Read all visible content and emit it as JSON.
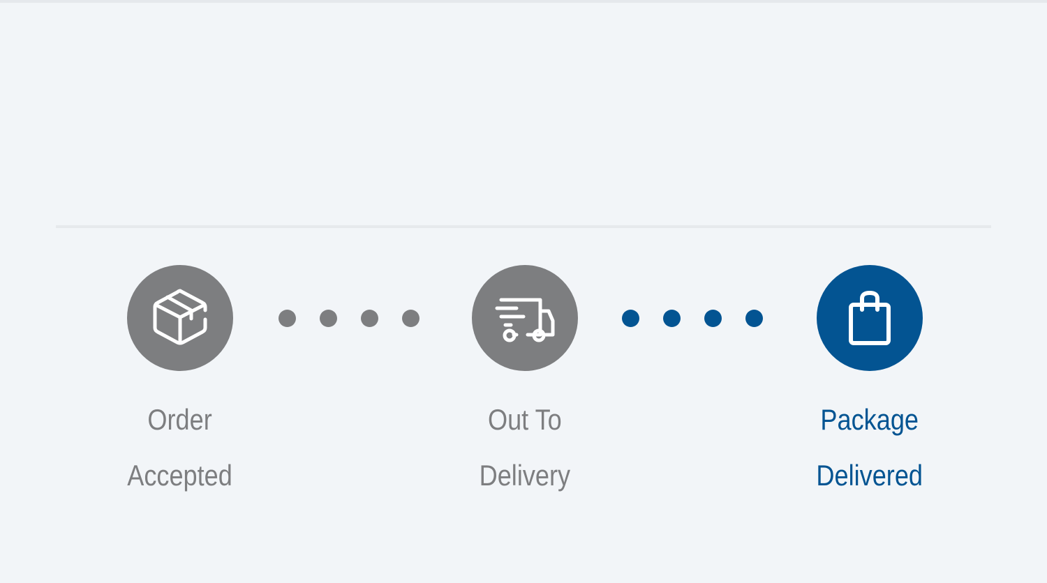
{
  "colors": {
    "inactive": "#7d7e80",
    "active": "#035492",
    "background": "#f2f5f8"
  },
  "tracker": {
    "steps": [
      {
        "icon": "package-box-icon",
        "state": "inactive",
        "label_line1": "Order",
        "label_line2": "Accepted"
      },
      {
        "icon": "delivery-truck-icon",
        "state": "inactive",
        "label_line1": "Out To",
        "label_line2": "Delivery"
      },
      {
        "icon": "shopping-bag-icon",
        "state": "active",
        "label_line1": "Package",
        "label_line2": "Delivered"
      }
    ],
    "connectors": [
      {
        "state": "inactive",
        "dots": 4
      },
      {
        "state": "active",
        "dots": 4
      }
    ]
  }
}
